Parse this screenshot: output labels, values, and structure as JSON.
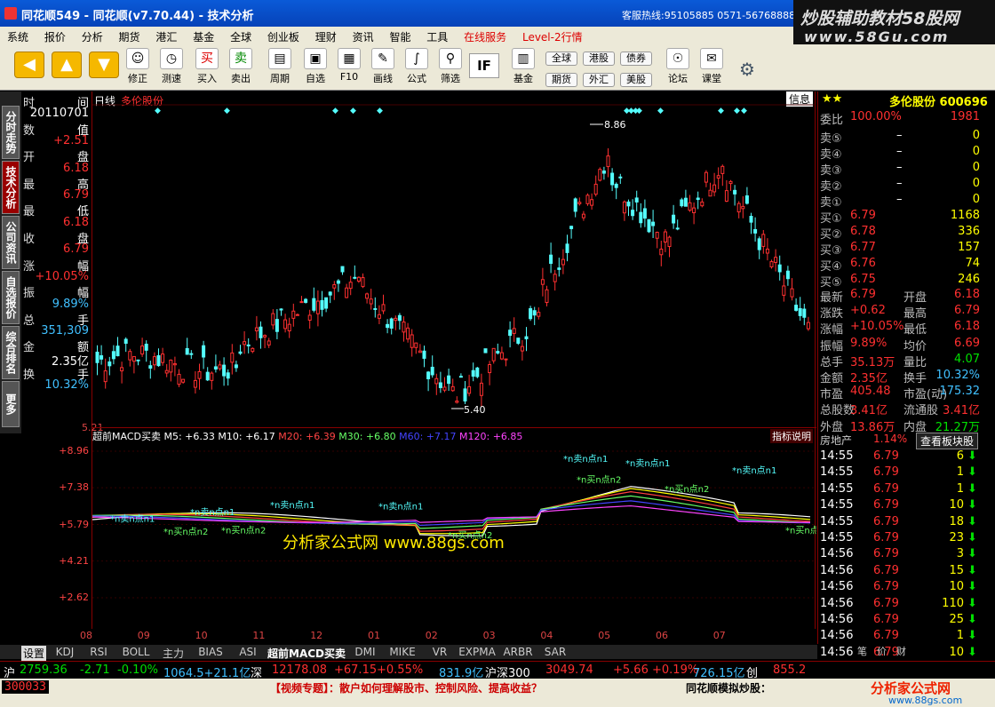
{
  "title": "同花顺549 - 同花顺(v7.70.44) - 技术分析",
  "hotline": "客服热线:95105885 0571-56768888",
  "brand": {
    "line1": "炒股辅助教材58股网",
    "line2": "www.58Gu.com"
  },
  "menu": [
    "系统",
    "报价",
    "分析",
    "期货",
    "港汇",
    "基金",
    "全球",
    "创业板",
    "理财",
    "资讯",
    "智能",
    "工具",
    "在线服务",
    "Level-2行情"
  ],
  "toolbar": {
    "buttons": [
      "修正",
      "测速",
      "买入",
      "卖出",
      "周期",
      "自选",
      "F10",
      "画线",
      "公式",
      "筛选",
      "基金",
      "论坛",
      "课堂"
    ],
    "pills": [
      "全球",
      "港股",
      "债券",
      "期货",
      "外汇",
      "美股"
    ]
  },
  "lefttabs": [
    "分时走势",
    "技术分析",
    "公司资讯",
    "自选报价",
    "综合排名",
    "更多"
  ],
  "leftinfo": [
    {
      "k": "时",
      "v": "间"
    },
    {
      "k": "",
      "v": "20110701"
    },
    {
      "k": "数",
      "v": "值"
    },
    {
      "k": "",
      "v": "+2.51"
    },
    {
      "k": "开",
      "v": "盘"
    },
    {
      "k": "",
      "v": "6.18"
    },
    {
      "k": "最",
      "v": "高"
    },
    {
      "k": "",
      "v": "6.79"
    },
    {
      "k": "最",
      "v": "低"
    },
    {
      "k": "",
      "v": "6.18"
    },
    {
      "k": "收",
      "v": "盘"
    },
    {
      "k": "",
      "v": "6.79"
    },
    {
      "k": "涨",
      "v": "幅"
    },
    {
      "k": "",
      "v": "+10.05%"
    },
    {
      "k": "振",
      "v": "幅"
    },
    {
      "k": "",
      "v": "9.89%"
    },
    {
      "k": "总",
      "v": "手"
    },
    {
      "k": "",
      "v": "351,309"
    },
    {
      "k": "金",
      "v": "额"
    },
    {
      "k": "",
      "v": "2.35亿"
    },
    {
      "k": "换",
      "v": "手"
    },
    {
      "k": "",
      "v": "10.32%"
    }
  ],
  "chart": {
    "mode": "日线",
    "name": "多伦股份",
    "info_label": "信息",
    "high_label": "8.86",
    "low_label": "5.40",
    "price_axis_bottom": "5.21",
    "sub_title": "超前MACD买卖",
    "m5": "M5: +6.33",
    "m10": "M10: +6.17",
    "m20": "M20: +6.39",
    "m30": "M30: +6.80",
    "m60": "M60: +7.17",
    "m120": "M120: +6.85",
    "explain": "指标说明",
    "sub_ticks": [
      "+8.96",
      "+7.38",
      "+5.79",
      "+4.21",
      "+2.62"
    ],
    "watermark": "分析家公式网 www.88gs.com",
    "sell_label": "*n卖n点n1",
    "buy_label": "*n买n点n2",
    "months": [
      "08",
      "09",
      "10",
      "11",
      "12",
      "01",
      "02",
      "03",
      "04",
      "05",
      "06",
      "07"
    ]
  },
  "chart_data": {
    "type": "line",
    "title": "",
    "series": [
      {
        "name": "M5",
        "last": 6.33
      },
      {
        "name": "M10",
        "last": 6.17
      },
      {
        "name": "M20",
        "last": 6.39
      },
      {
        "name": "M30",
        "last": 6.8
      },
      {
        "name": "M60",
        "last": 7.17
      },
      {
        "name": "M120",
        "last": 6.85
      }
    ],
    "price_high": 8.86,
    "price_low": 5.4
  },
  "right": {
    "stock": "多伦股份 600696",
    "stars": "★★",
    "weibi": {
      "label": "委比",
      "v": "100.00%",
      "n": "1981"
    },
    "sells": [
      [
        "卖⑤",
        "–",
        "0"
      ],
      [
        "卖④",
        "–",
        "0"
      ],
      [
        "卖③",
        "–",
        "0"
      ],
      [
        "卖②",
        "–",
        "0"
      ],
      [
        "卖①",
        "–",
        "0"
      ]
    ],
    "buys": [
      [
        "买①",
        "6.79",
        "1168"
      ],
      [
        "买②",
        "6.78",
        "336"
      ],
      [
        "买③",
        "6.77",
        "157"
      ],
      [
        "买④",
        "6.76",
        "74"
      ],
      [
        "买⑤",
        "6.75",
        "246"
      ]
    ],
    "stats": [
      [
        "最新",
        "6.79",
        "开盘",
        "6.18"
      ],
      [
        "涨跌",
        "+0.62",
        "最高",
        "6.79"
      ],
      [
        "涨幅",
        "+10.05%",
        "最低",
        "6.18"
      ],
      [
        "振幅",
        "9.89%",
        "均价",
        "6.69"
      ],
      [
        "总手",
        "35.13万",
        "量比",
        "4.07"
      ],
      [
        "金额",
        "2.35亿",
        "换手",
        "10.32%"
      ],
      [
        "市盈",
        "405.48",
        "市盈(动)",
        "175.32"
      ],
      [
        "总股数",
        "3.41亿",
        "流通股",
        "3.41亿"
      ],
      [
        "外盘",
        "13.86万",
        "内盘",
        "21.27万"
      ]
    ],
    "sector": "房地产",
    "sector_pct": "1.14%",
    "sector_btn": "查看板块股",
    "ticks": [
      [
        "14:55",
        "6.79",
        "6"
      ],
      [
        "14:55",
        "6.79",
        "1"
      ],
      [
        "14:55",
        "6.79",
        "1"
      ],
      [
        "14:55",
        "6.79",
        "10"
      ],
      [
        "14:55",
        "6.79",
        "18"
      ],
      [
        "14:55",
        "6.79",
        "23"
      ],
      [
        "14:56",
        "6.79",
        "3"
      ],
      [
        "14:56",
        "6.79",
        "15"
      ],
      [
        "14:56",
        "6.79",
        "10"
      ],
      [
        "14:56",
        "6.79",
        "110"
      ],
      [
        "14:56",
        "6.79",
        "25"
      ],
      [
        "14:56",
        "6.79",
        "1"
      ],
      [
        "14:56",
        "6.79",
        "10"
      ]
    ],
    "small_tabs": [
      "笔",
      "价",
      "财"
    ]
  },
  "bottomtabs": [
    "设置",
    "KDJ",
    "RSI",
    "BOLL",
    "主力",
    "BIAS",
    "ASI",
    "超前MACD买卖",
    "DMI",
    "MIKE",
    "VR",
    "EXPMA",
    "ARBR",
    "SAR"
  ],
  "ticker": {
    "sh": "沪",
    "sh_v": "2759.36",
    "sh_c": "-2.71",
    "sh_p": "-0.10%",
    "sh_a": "1064.5+21.1亿",
    "sz": "深",
    "sz_v": "12178.08",
    "sz_c": "+67.15",
    "sz_p": "+0.55%",
    "sz_a": "831.9亿",
    "hs": "沪深300",
    "hs_v": "3049.74",
    "hs_c": "+5.66",
    "hs_p": "+0.19%",
    "hs_a": "726.15亿",
    "cy": "创",
    "cy_v": "855.2"
  },
  "status": {
    "code": "300033",
    "news": "【视频专题】：散户如何理解股市、控制风险、提高收益？",
    "sim": "同花顺模拟炒股：",
    "logo": "分析家公式网",
    "logo_url": "www.88gs.com"
  }
}
